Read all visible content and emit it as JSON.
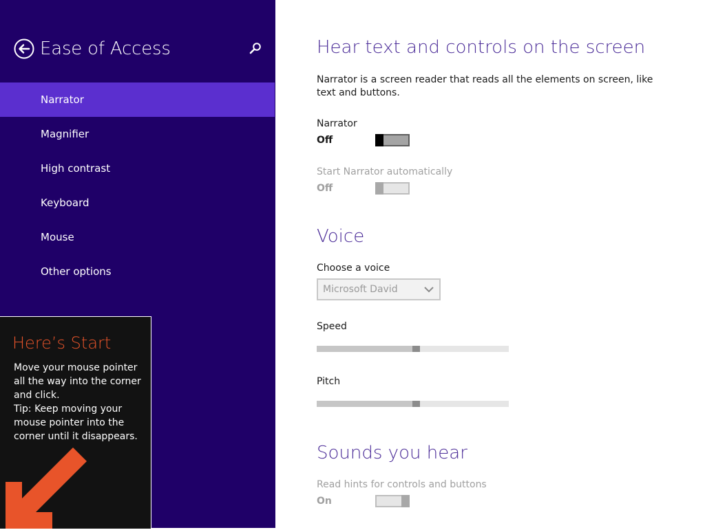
{
  "app": {
    "title": "Ease of Access",
    "back_icon": "back-arrow-circle-icon",
    "search_icon": "search-icon"
  },
  "nav": {
    "items": [
      {
        "label": "Narrator",
        "selected": true
      },
      {
        "label": "Magnifier",
        "selected": false
      },
      {
        "label": "High contrast",
        "selected": false
      },
      {
        "label": "Keyboard",
        "selected": false
      },
      {
        "label": "Mouse",
        "selected": false
      },
      {
        "label": "Other options",
        "selected": false
      }
    ]
  },
  "tip": {
    "title": "Here’s Start",
    "body": "Move your mouse pointer\nall the way into the corner\nand click.\nTip: Keep moving your\nmouse pointer into the\ncorner until it disappears.",
    "arrow_icon": "arrow-down-left-icon"
  },
  "main": {
    "hear": {
      "heading": "Hear text and controls on the screen",
      "description": "Narrator is a screen reader that reads all the elements on screen, like text and buttons.",
      "narrator": {
        "label": "Narrator",
        "state": "Off"
      },
      "auto_start": {
        "label": "Start Narrator automatically",
        "state": "Off"
      }
    },
    "voice": {
      "heading": "Voice",
      "choose_label": "Choose a voice",
      "choose_value": "Microsoft David",
      "speed_label": "Speed",
      "speed_value": 0.5,
      "pitch_label": "Pitch",
      "pitch_value": 0.5
    },
    "sounds": {
      "heading": "Sounds you hear",
      "hints": {
        "label": "Read hints for controls and buttons",
        "state": "On"
      }
    }
  },
  "colors": {
    "nav_bg": "#1f0068",
    "nav_selected": "#5b2fcf",
    "heading": "#4b2c98",
    "tip_title": "#e8542a"
  }
}
